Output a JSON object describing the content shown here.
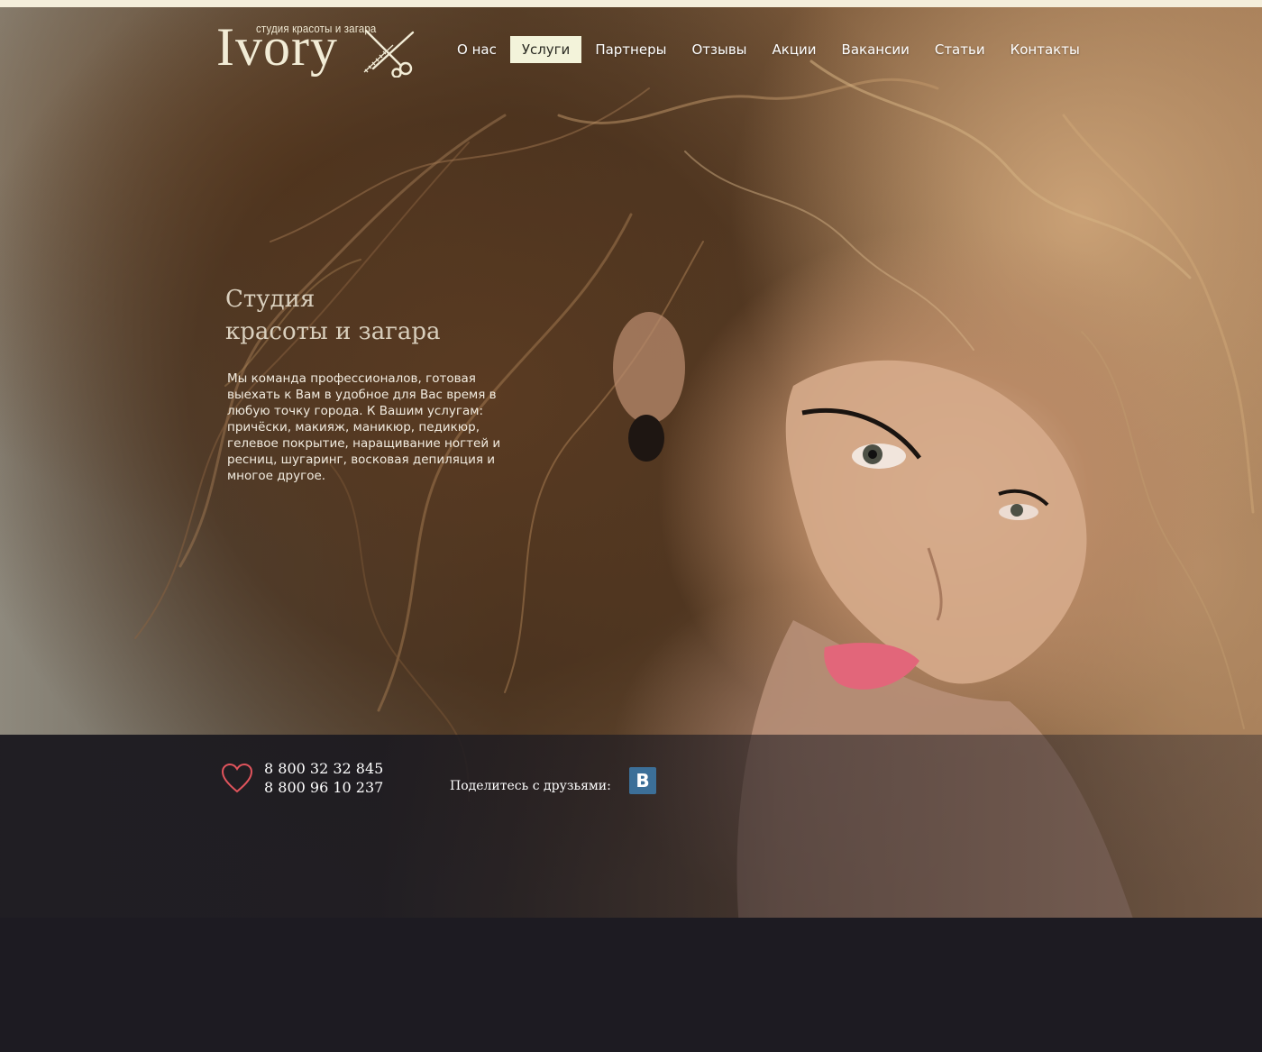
{
  "brand": {
    "name": "Ivory",
    "tagline": "студия красоты и загара"
  },
  "nav": {
    "items": [
      {
        "label": "О нас"
      },
      {
        "label": "Услуги",
        "active": true
      },
      {
        "label": "Партнеры"
      },
      {
        "label": "Отзывы"
      },
      {
        "label": "Акции"
      },
      {
        "label": "Вакансии"
      },
      {
        "label": "Статьи"
      },
      {
        "label": "Контакты"
      }
    ]
  },
  "hero": {
    "title_line1": "Студия",
    "title_line2": "красоты и загара",
    "description": "Мы команда профессионалов, готовая выехать к Вам в удобное для Вас время в любую точку города. К Вашим услугам: причёски, макияж, маникюр, педикюр, гелевое покрытие, наращивание ногтей и ресниц, шугаринг, восковая депиляция и многое другое."
  },
  "contacts": {
    "phone1": "8 800 32 32 845",
    "phone2": "8 800 96 10 237",
    "share_label": "Поделитесь с друзьями:",
    "vk_letter": "B"
  },
  "colors": {
    "nav_active_bg": "#f3f3da",
    "heart": "#e0545c",
    "vk": "#3c6f98",
    "footer_bg": "#1d1b22"
  },
  "icons": [
    "scissors-icon",
    "comb-icon",
    "heart-icon",
    "vk-icon"
  ]
}
